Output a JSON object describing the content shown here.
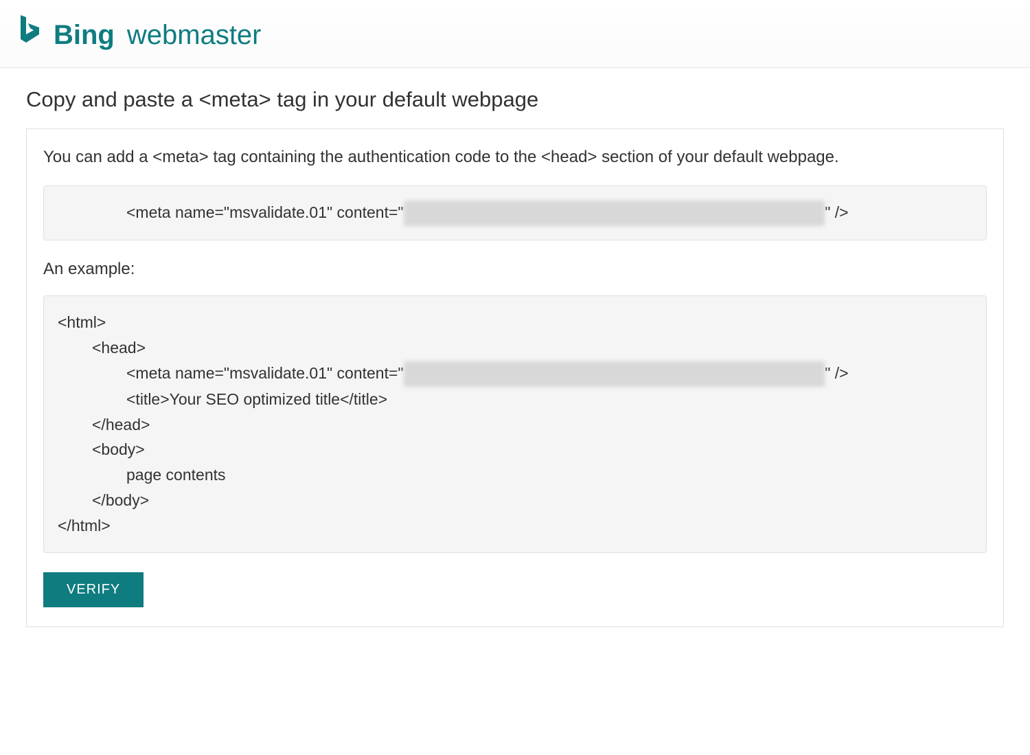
{
  "header": {
    "brand_name": "Bing",
    "product_name": "webmaster",
    "brand_color": "#0f7c80"
  },
  "main": {
    "section_title": "Copy and paste a <meta> tag in your default webpage",
    "instruction": "You can add a <meta> tag containing the authentication code to the <head> section of your default webpage.",
    "meta_tag_prefix": "<meta name=\"msvalidate.01\" content=\"",
    "meta_tag_suffix": "\" />",
    "example_label": "An example:",
    "example_code": {
      "line1": "<html>",
      "line2": "<head>",
      "line3_prefix": "<meta name=\"msvalidate.01\" content=\"",
      "line3_suffix": "\" />",
      "line4": "<title>Your SEO optimized title</title>",
      "line5": "</head>",
      "line6": "<body>",
      "line7": "page contents",
      "line8": "</body>",
      "line9": "</html>"
    },
    "verify_button_label": "VERIFY"
  }
}
